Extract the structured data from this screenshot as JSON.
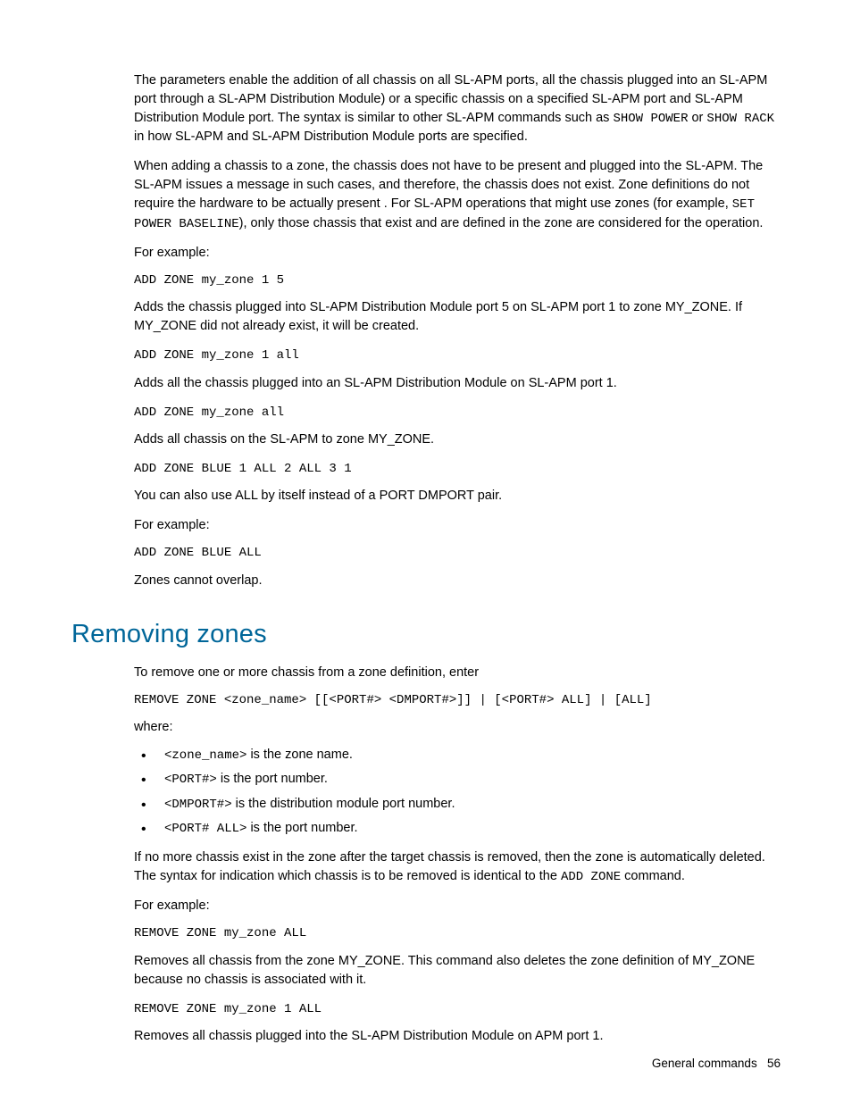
{
  "p1_a": "The parameters enable the addition of all chassis on all SL-APM ports, all the chassis plugged into an SL-APM port through a SL-APM Distribution Module) or a specific chassis on a specified SL-APM port and SL-APM Distribution Module port. The syntax is similar to other SL-APM commands such as ",
  "p1_code1": "SHOW POWER",
  "p1_b": " or ",
  "p1_code2": "SHOW RACK",
  "p1_c": " in how SL-APM and SL-APM Distribution Module ports are specified.",
  "p2_a": "When adding a chassis to a zone, the chassis does not have to be present and plugged into the SL-APM. The SL-APM issues a message in such cases, and therefore, the chassis does not exist. Zone definitions do not require the hardware to be actually present . For SL-APM operations that might use zones (for example, ",
  "p2_code1": "SET POWER BASELINE",
  "p2_b": "), only those chassis that exist and are defined in the zone are considered for the operation.",
  "p3": "For example:",
  "code1": "ADD ZONE my_zone 1 5",
  "p4": "Adds the chassis plugged into SL-APM Distribution Module port 5 on SL-APM port 1 to zone MY_ZONE. If MY_ZONE did not already exist, it will be created.",
  "code2": "ADD ZONE my_zone 1 all",
  "p5": "Adds all the chassis plugged into an SL-APM Distribution Module on SL-APM port 1.",
  "code3": "ADD ZONE my_zone all",
  "p6": "Adds all chassis on the SL-APM to zone MY_ZONE.",
  "code4": "ADD ZONE BLUE 1 ALL 2 ALL 3 1",
  "p7": "You can also use ALL by itself instead of a PORT DMPORT pair.",
  "p8": "For example:",
  "code5": "ADD ZONE BLUE ALL",
  "p9": "Zones cannot overlap.",
  "heading": "Removing zones",
  "r1": "To remove one or more chassis from a zone definition, enter",
  "rcode1": "REMOVE ZONE <zone_name> [[<PORT#> <DMPORT#>]] | [<PORT#> ALL] | [ALL]",
  "r2": "where:",
  "bullets": [
    {
      "code": "<zone_name>",
      "text": " is the zone name."
    },
    {
      "code": "<PORT#>",
      "text": " is the port number."
    },
    {
      "code": "<DMPORT#>",
      "text": " is the distribution module port number."
    },
    {
      "code": "<PORT# ALL>",
      "text": " is the port number."
    }
  ],
  "r3_a": "If no more chassis exist in the zone after the target chassis is removed, then the zone is automatically deleted. The syntax for indication which chassis is to be removed is identical to the ",
  "r3_code": "ADD ZONE",
  "r3_b": " command.",
  "r4": "For example:",
  "rcode2": "REMOVE ZONE my_zone ALL",
  "r5": "Removes all chassis from the zone MY_ZONE. This command also deletes the zone definition of MY_ZONE because no chassis is associated with it.",
  "rcode3": "REMOVE ZONE my_zone 1 ALL",
  "r6": "Removes all chassis plugged into the SL-APM Distribution Module on APM port 1.",
  "footer_section": "General commands",
  "footer_page": "56"
}
